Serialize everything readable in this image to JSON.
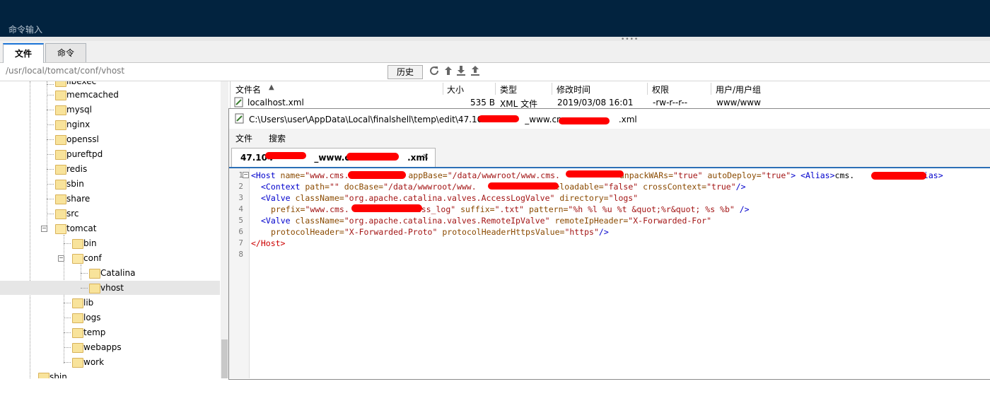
{
  "header": {
    "command_input_label": "命令输入"
  },
  "tabs": [
    {
      "label": "文件",
      "active": true
    },
    {
      "label": "命令",
      "active": false
    }
  ],
  "pathbar": {
    "path": "/usr/local/tomcat/conf/vhost",
    "history_label": "历史"
  },
  "toolbar_icons": [
    "refresh-icon",
    "up-arrow-icon",
    "download-icon",
    "upload-icon"
  ],
  "tree": {
    "items": [
      {
        "label": "libexec",
        "level": 1
      },
      {
        "label": "memcached",
        "level": 1
      },
      {
        "label": "mysql",
        "level": 1
      },
      {
        "label": "nginx",
        "level": 1
      },
      {
        "label": "openssl",
        "level": 1
      },
      {
        "label": "pureftpd",
        "level": 1
      },
      {
        "label": "redis",
        "level": 1
      },
      {
        "label": "sbin",
        "level": 1
      },
      {
        "label": "share",
        "level": 1
      },
      {
        "label": "src",
        "level": 1
      },
      {
        "label": "tomcat",
        "level": 1
      },
      {
        "label": "bin",
        "level": 2
      },
      {
        "label": "conf",
        "level": 2
      },
      {
        "label": "Catalina",
        "level": 3
      },
      {
        "label": "vhost",
        "level": 3,
        "selected": true
      },
      {
        "label": "lib",
        "level": 2
      },
      {
        "label": "logs",
        "level": 2
      },
      {
        "label": "temp",
        "level": 2
      },
      {
        "label": "webapps",
        "level": 2
      },
      {
        "label": "work",
        "level": 2
      },
      {
        "label": "sbin",
        "level": 0
      }
    ]
  },
  "filelist": {
    "columns": [
      "文件名",
      "大小",
      "类型",
      "修改时间",
      "权限",
      "用户/用户组"
    ],
    "rows": [
      {
        "name": "localhost.xml",
        "size": "535 B",
        "type": "XML 文件",
        "modified": "2019/03/08 16:01",
        "perm": "-rw-r--r--",
        "owner": "www/www"
      }
    ]
  },
  "editor": {
    "title_prefix": "C:\\Users\\user\\AppData\\Local\\finalshell\\temp\\edit\\47.10",
    "title_mid": "_www.cms.",
    "title_suffix": ".xml",
    "menu": [
      "文件",
      "搜索"
    ],
    "tab_prefix": "47.104",
    "tab_mid": "_www.cms",
    "tab_suffix": ".xml",
    "tab_close": "×",
    "line_numbers": [
      "1",
      "2",
      "3",
      "4",
      "5",
      "6",
      "7",
      "8"
    ],
    "lines": {
      "l1": {
        "open": "<Host",
        "a1": " name=",
        "v1": "\"www.cms.",
        "v1end": "\"",
        "a2": " appBase=",
        "v2": "\"/data/wwwroot/www.cms.",
        "v2end": "\"",
        "a3": " unpackWARs=",
        "v3": "\"true\"",
        "a4": " autoDeploy=",
        "v4": "\"true\"",
        "close": ">",
        "alias_open": " <Alias>",
        "alias_text": "cms.",
        "alias_close": "</Alias>"
      },
      "l2": {
        "open": "<Context",
        "a1": " path=",
        "v1": "\"\"",
        "a2": " docBase=",
        "v2": "\"/data/wwwroot/www.",
        "v2end": "\"",
        "a3": " reloadable=",
        "v3": "\"false\"",
        "a4": " crossContext=",
        "v4": "\"true\"",
        "close": "/>"
      },
      "l3": {
        "open": "<Valve",
        "a1": " className=",
        "v1": "\"org.apache.catalina.valves.AccessLogValve\"",
        "a2": " directory=",
        "v2": "\"logs\""
      },
      "l4": {
        "a1": "prefix=",
        "v1": "\"www.cms.",
        "v1end": "ess_log\"",
        "a2": " suffix=",
        "v2": "\".txt\"",
        "a3": " pattern=",
        "v3": "\"%h %l %u %t &quot;%r&quot; %s %b\"",
        "close": " />"
      },
      "l5": {
        "open": "<Valve",
        "a1": " className=",
        "v1": "\"org.apache.catalina.valves.RemoteIpValve\"",
        "a2": " remoteIpHeader=",
        "v2": "\"X-Forwarded-For\""
      },
      "l6": {
        "a1": "protocolHeader=",
        "v1": "\"X-Forwarded-Proto\"",
        "a2": " protocolHeaderHttpsValue=",
        "v2": "\"https\"",
        "close": "/>"
      },
      "l7": {
        "close": "</Host>"
      }
    }
  },
  "colors": {
    "header_bg": "#02233f",
    "accent_blue": "#2b6fb6",
    "redaction": "#ff0000"
  }
}
